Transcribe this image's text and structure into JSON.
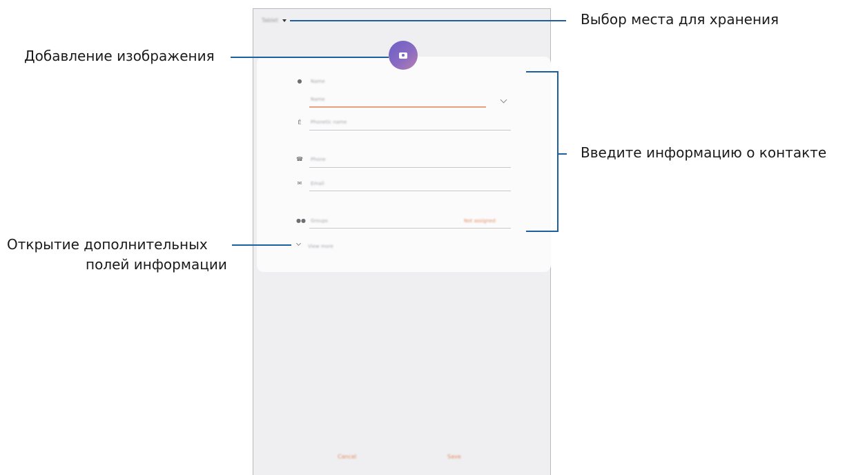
{
  "screen": {
    "storage_selector": "Tablet",
    "fields": {
      "name_label": "Name",
      "name_value": "Name",
      "phonetic_label": "Phonetic name",
      "phone_label": "Phone",
      "email_label": "Email",
      "groups_label": "Groups",
      "groups_value": "Not assigned",
      "view_more": "View more"
    },
    "buttons": {
      "cancel": "Cancel",
      "save": "Save"
    }
  },
  "callouts": {
    "storage": "Выбор места для хранения",
    "add_image": "Добавление изображения",
    "enter_info": "Введите информацию о контакте",
    "more_fields_line1": "Открытие дополнительных",
    "more_fields_line2": "полей информации"
  },
  "colors": {
    "accent": "#e58a63",
    "callout_line": "#1b5fa0",
    "avatar_gradient_start": "#6a5fc8",
    "avatar_gradient_end": "#b77fb0"
  },
  "icons": [
    "caret-down-icon",
    "camera-icon",
    "person-icon",
    "phonetic-icon",
    "phone-icon",
    "email-icon",
    "groups-icon",
    "chevron-down-icon"
  ]
}
